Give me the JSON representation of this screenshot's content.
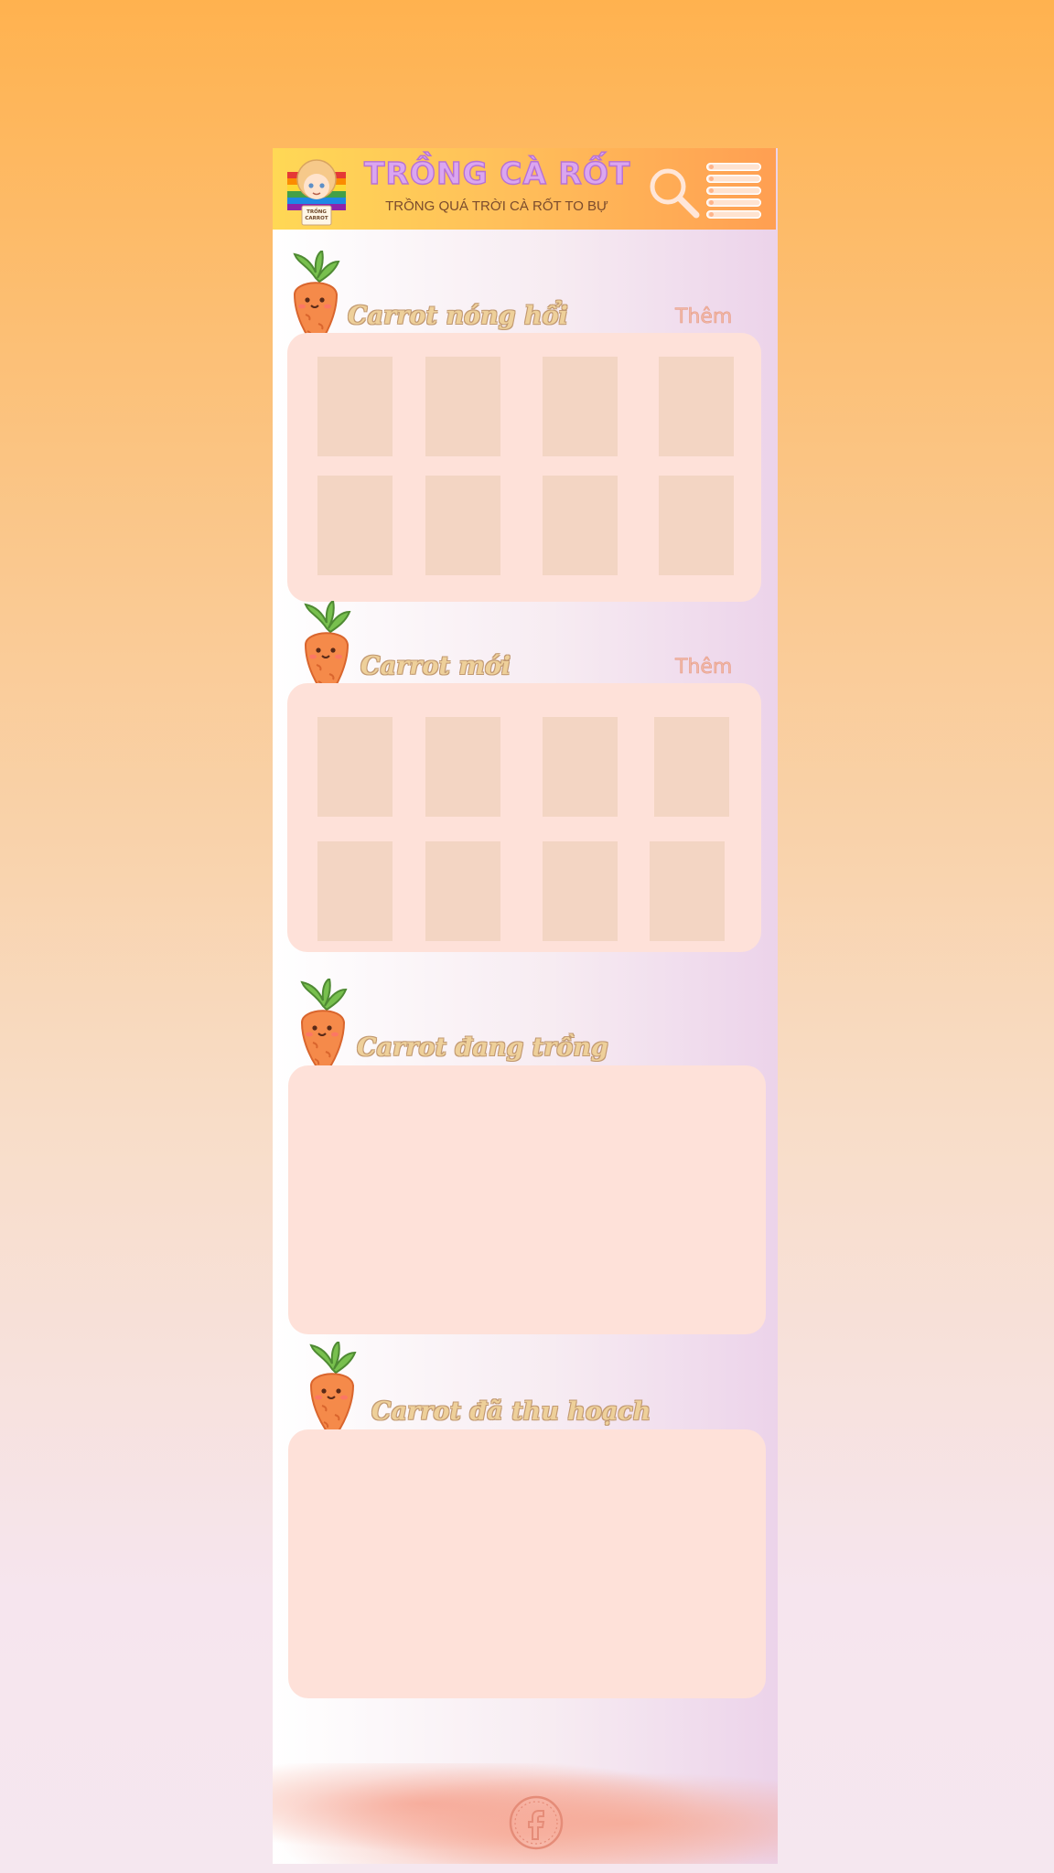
{
  "header": {
    "title": "TRỒNG CÀ RỐT",
    "subtitle": "TRỒNG QUÁ TRỜI CÀ RỐT TO BỰ",
    "avatar_badge": "TRỒNG CARROT"
  },
  "sections": [
    {
      "title": "Carrot nóng hổi",
      "more": "Thêm"
    },
    {
      "title": "Carrot mới",
      "more": "Thêm"
    },
    {
      "title": "Carrot đang trồng"
    },
    {
      "title": "Carrot đã thu hoạch"
    }
  ],
  "icons": {
    "search": "search-icon",
    "menu": "menu-icon",
    "section": "carrot-icon",
    "footer": "facebook-icon"
  },
  "colors": {
    "header_start": "#ffd855",
    "header_end": "#ff9f52",
    "title": "#dba6f0",
    "section_title": "#eed09a",
    "more": "#f1b8a6",
    "panel": "#fee1d9",
    "tile": "#f3d5c3"
  }
}
